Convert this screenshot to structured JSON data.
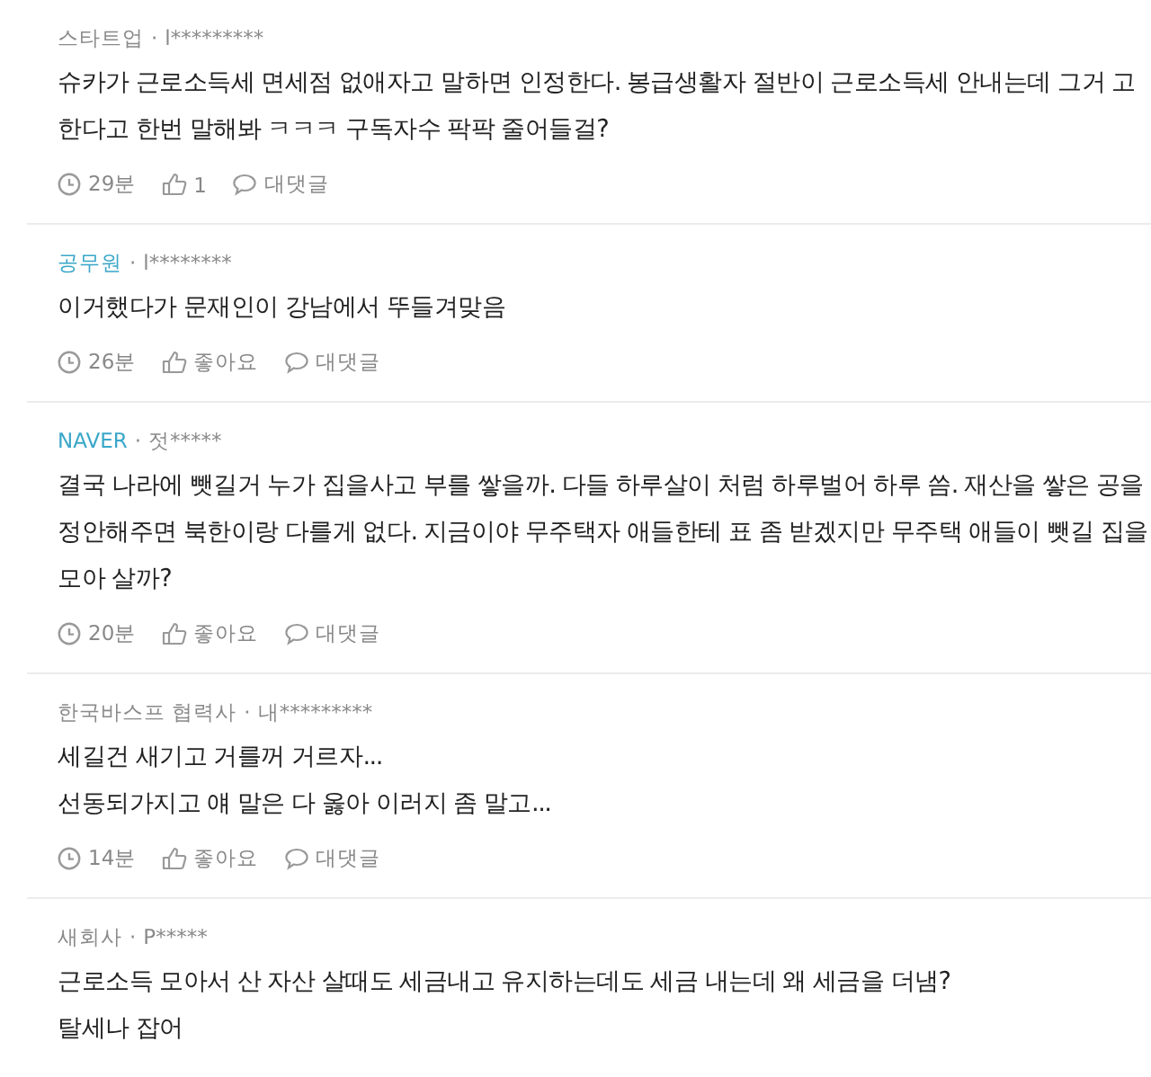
{
  "comments": [
    {
      "group": "스타트업",
      "color": "#8a8a8a",
      "sep": "·",
      "author": "l*********",
      "lines": [
        "슈카가 근로소득세 면세점 없애자고 말하면 인정한다. 봉급생활자 절반이 근로소득세 안내는데 그거 고",
        "한다고 한번 말해봐 ㅋㅋㅋ 구독자수 팍팍 줄어들걸?"
      ],
      "time": "29분",
      "likes": "1",
      "reply": "대댓글"
    },
    {
      "group": "공무원",
      "color": "#3aa7c9",
      "sep": "·",
      "author": "l********",
      "lines": [
        "이거했다가 문재인이 강남에서 뚜들겨맞음"
      ],
      "time": "26분",
      "likes": "좋아요",
      "reply": "대댓글"
    },
    {
      "group": "NAVER",
      "color": "#3aa7c9",
      "sep": "·",
      "author": "젓*****",
      "lines": [
        "결국 나라에 뺏길거 누가 집을사고 부를 쌓을까. 다들 하루살이 처럼 하루벌어 하루 씀. 재산을 쌓은 공을",
        "정안해주면 북한이랑 다를게 없다. 지금이야 무주택자 애들한테 표 좀 받겠지만 무주택 애들이 뺏길 집을",
        "모아 살까?"
      ],
      "time": "20분",
      "likes": "좋아요",
      "reply": "대댓글"
    },
    {
      "group": "한국바스프 협력사",
      "color": "#8a8a8a",
      "sep": "·",
      "author": "내*********",
      "lines": [
        "세길건 새기고 거를꺼 거르자...",
        "선동되가지고 얘 말은 다 옳아 이러지 좀 말고..."
      ],
      "time": "14분",
      "likes": "좋아요",
      "reply": "대댓글"
    },
    {
      "group": "새회사",
      "color": "#8a8a8a",
      "sep": "·",
      "author": "P*****",
      "lines": [
        "근로소득 모아서 산 자산 살때도 세금내고 유지하는데도 세금 내는데 왜 세금을 더냄?",
        "탈세나 잡어"
      ]
    }
  ]
}
